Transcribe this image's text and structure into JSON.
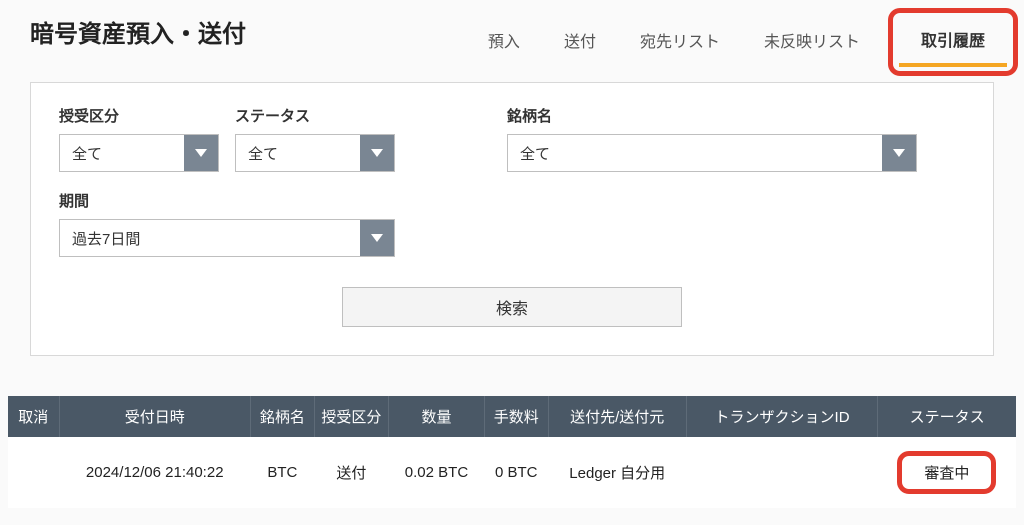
{
  "header": {
    "title": "暗号資産預入・送付",
    "tabs": {
      "deposit": "預入",
      "send": "送付",
      "address_list": "宛先リスト",
      "unreflected": "未反映リスト",
      "history": "取引履歴"
    }
  },
  "filters": {
    "side": {
      "label": "授受区分",
      "value": "全て"
    },
    "status": {
      "label": "ステータス",
      "value": "全て"
    },
    "symbol": {
      "label": "銘柄名",
      "value": "全て"
    },
    "period": {
      "label": "期間",
      "value": "過去7日間"
    }
  },
  "actions": {
    "search": "検索"
  },
  "table": {
    "headers": {
      "cancel": "取消",
      "datetime": "受付日時",
      "symbol": "銘柄名",
      "side": "授受区分",
      "quantity": "数量",
      "fee": "手数料",
      "destination": "送付先/送付元",
      "txid": "トランザクションID",
      "status": "ステータス"
    },
    "rows": [
      {
        "cancel": "",
        "datetime": "2024/12/06 21:40:22",
        "symbol": "BTC",
        "side": "送付",
        "quantity": "0.02 BTC",
        "fee": "0 BTC",
        "destination": "Ledger 自分用",
        "txid": "",
        "status": "審査中"
      }
    ]
  }
}
